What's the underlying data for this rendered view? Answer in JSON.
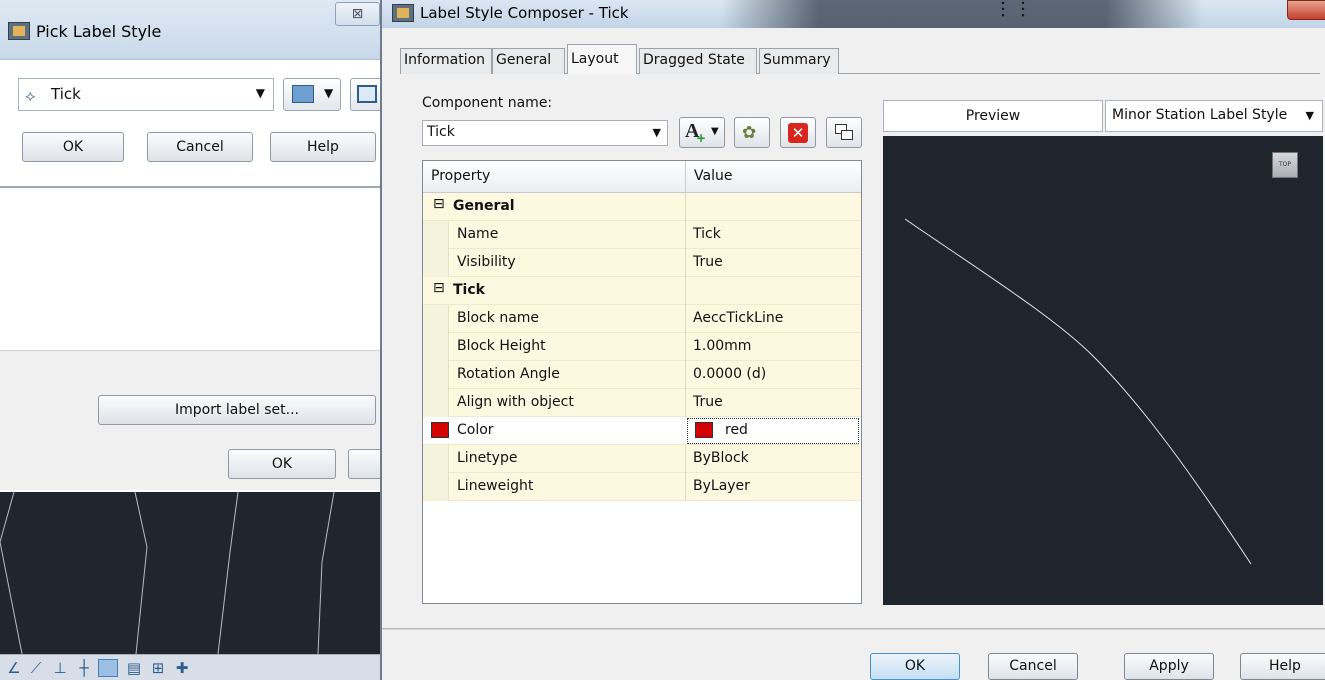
{
  "background_window": {
    "title": "Pick Label Style",
    "close_glyph": "⊠",
    "style_combo_value": "Tick",
    "ok_label": "OK",
    "cancel_label": "Cancel",
    "help_label": "Help",
    "import_label": "Import label set...",
    "ok2_label": "OK"
  },
  "dialog": {
    "title": "Label Style Composer - Tick",
    "title_glyph": "︙︙",
    "tabs": [
      {
        "label": "Information",
        "active": false
      },
      {
        "label": "General",
        "active": false
      },
      {
        "label": "Layout",
        "active": true
      },
      {
        "label": "Dragged State",
        "active": false
      },
      {
        "label": "Summary",
        "active": false
      }
    ],
    "component_label": "Component name:",
    "component_value": "Tick",
    "property_header": "Property",
    "value_header": "Value",
    "rows": [
      {
        "kind": "category",
        "toggle": "⊟",
        "name": "General"
      },
      {
        "name": "Name",
        "value": "Tick"
      },
      {
        "name": "Visibility",
        "value": "True"
      },
      {
        "kind": "category",
        "toggle": "⊟",
        "name": "Tick"
      },
      {
        "name": "Block name",
        "value": "AeccTickLine"
      },
      {
        "name": "Block Height",
        "value": "1.00mm"
      },
      {
        "name": "Rotation Angle",
        "value": "0.0000 (d)"
      },
      {
        "name": "Align with object",
        "value": "True"
      },
      {
        "name": "Color",
        "value": "red",
        "selected": true
      },
      {
        "name": "Linetype",
        "value": "ByBlock"
      },
      {
        "name": "Lineweight",
        "value": "ByLayer"
      }
    ],
    "preview_label": "Preview",
    "preview_style": "Minor Station Label Style",
    "viewcube_label": "TOP",
    "buttons": {
      "ok": "OK",
      "cancel": "Cancel",
      "apply": "Apply",
      "help": "Help"
    }
  },
  "colors": {
    "swatch_red": "#d50000",
    "canvas_bg": "#1e252c",
    "grid_row_bg": "#fdf9e1",
    "preview_line": "#e6e6e6"
  }
}
